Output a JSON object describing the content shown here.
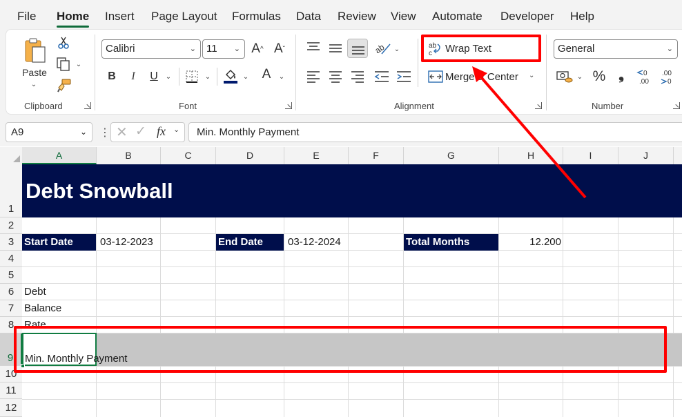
{
  "menu": [
    "File",
    "Home",
    "Insert",
    "Page Layout",
    "Formulas",
    "Data",
    "Review",
    "View",
    "Automate",
    "Developer",
    "Help"
  ],
  "clipboard": {
    "paste_label": "Paste",
    "group_label": "Clipboard"
  },
  "font": {
    "name": "Calibri",
    "size": "11",
    "group_label": "Font",
    "bold": "B",
    "italic": "I",
    "underline": "U",
    "grow": "A^",
    "shrink": "Aˇ",
    "font_color": "A"
  },
  "alignment": {
    "wrap_text": "Wrap Text",
    "merge_center": "Merge & Center",
    "group_label": "Alignment"
  },
  "number": {
    "format": "General",
    "group_label": "Number",
    "percent": "%",
    "comma": "9",
    "increase_decimal": ".00",
    "decrease_decimal": ".00"
  },
  "formula_bar": {
    "name_box": "A9",
    "fx": "fx",
    "value": "Min. Monthly Payment"
  },
  "columns": [
    "A",
    "B",
    "C",
    "D",
    "E",
    "F",
    "G",
    "H",
    "I",
    "J"
  ],
  "rows": [
    "1",
    "2",
    "3",
    "4",
    "5",
    "6",
    "7",
    "8",
    "9",
    "10",
    "11",
    "12"
  ],
  "sheet": {
    "title": "Debt Snowball",
    "start_date_label": "Start Date",
    "start_date_value": "03-12-2023",
    "end_date_label": "End Date",
    "end_date_value": "03-12-2024",
    "total_months_label": "Total Months",
    "total_months_value": "12.200",
    "a6": "Debt",
    "a7": "Balance",
    "a8": "Rate",
    "a9": "Min. Monthly Payment"
  },
  "colors": {
    "title_band": "#000e4b",
    "selection_green": "#107c41",
    "annotation_red": "#ff0000"
  }
}
